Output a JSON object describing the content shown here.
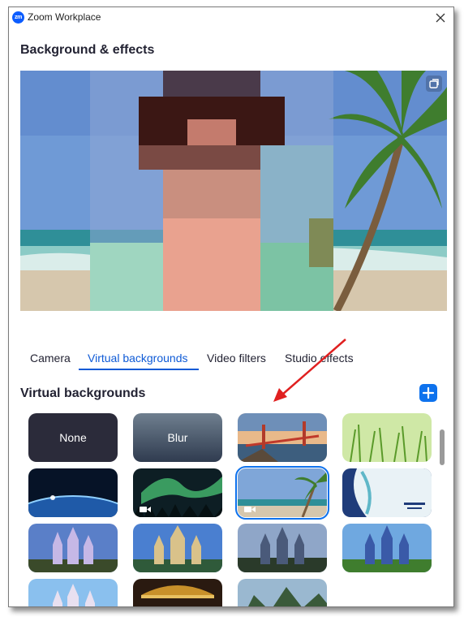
{
  "window": {
    "title": "Zoom Workplace",
    "logo_text": "zm"
  },
  "header": {
    "title": "Background & effects"
  },
  "tabs": [
    {
      "label": "Camera",
      "active": false
    },
    {
      "label": "Virtual backgrounds",
      "active": true
    },
    {
      "label": "Video filters",
      "active": false
    },
    {
      "label": "Studio effects",
      "active": false
    }
  ],
  "section": {
    "title": "Virtual backgrounds"
  },
  "backgrounds": [
    {
      "label": "None",
      "kind": "none"
    },
    {
      "label": "Blur",
      "kind": "blur"
    },
    {
      "label": "",
      "kind": "golden-gate"
    },
    {
      "label": "",
      "kind": "grass"
    },
    {
      "label": "",
      "kind": "earth"
    },
    {
      "label": "",
      "kind": "aurora",
      "video": true
    },
    {
      "label": "",
      "kind": "beach",
      "video": true,
      "selected": true
    },
    {
      "label": "",
      "kind": "slide"
    },
    {
      "label": "",
      "kind": "castle-1"
    },
    {
      "label": "",
      "kind": "castle-2"
    },
    {
      "label": "",
      "kind": "castle-3"
    },
    {
      "label": "",
      "kind": "castle-4"
    },
    {
      "label": "",
      "kind": "castle-5"
    },
    {
      "label": "",
      "kind": "carousel"
    },
    {
      "label": "",
      "kind": "mountain"
    }
  ],
  "icons": {
    "close": "close-icon",
    "expand": "expand-icon",
    "add": "plus-icon",
    "video": "video-camera-icon",
    "arrow": "red-arrow-annotation"
  },
  "colors": {
    "accent": "#0e72ed",
    "active_tab": "#0e5ad6",
    "annotation": "#e02020"
  }
}
